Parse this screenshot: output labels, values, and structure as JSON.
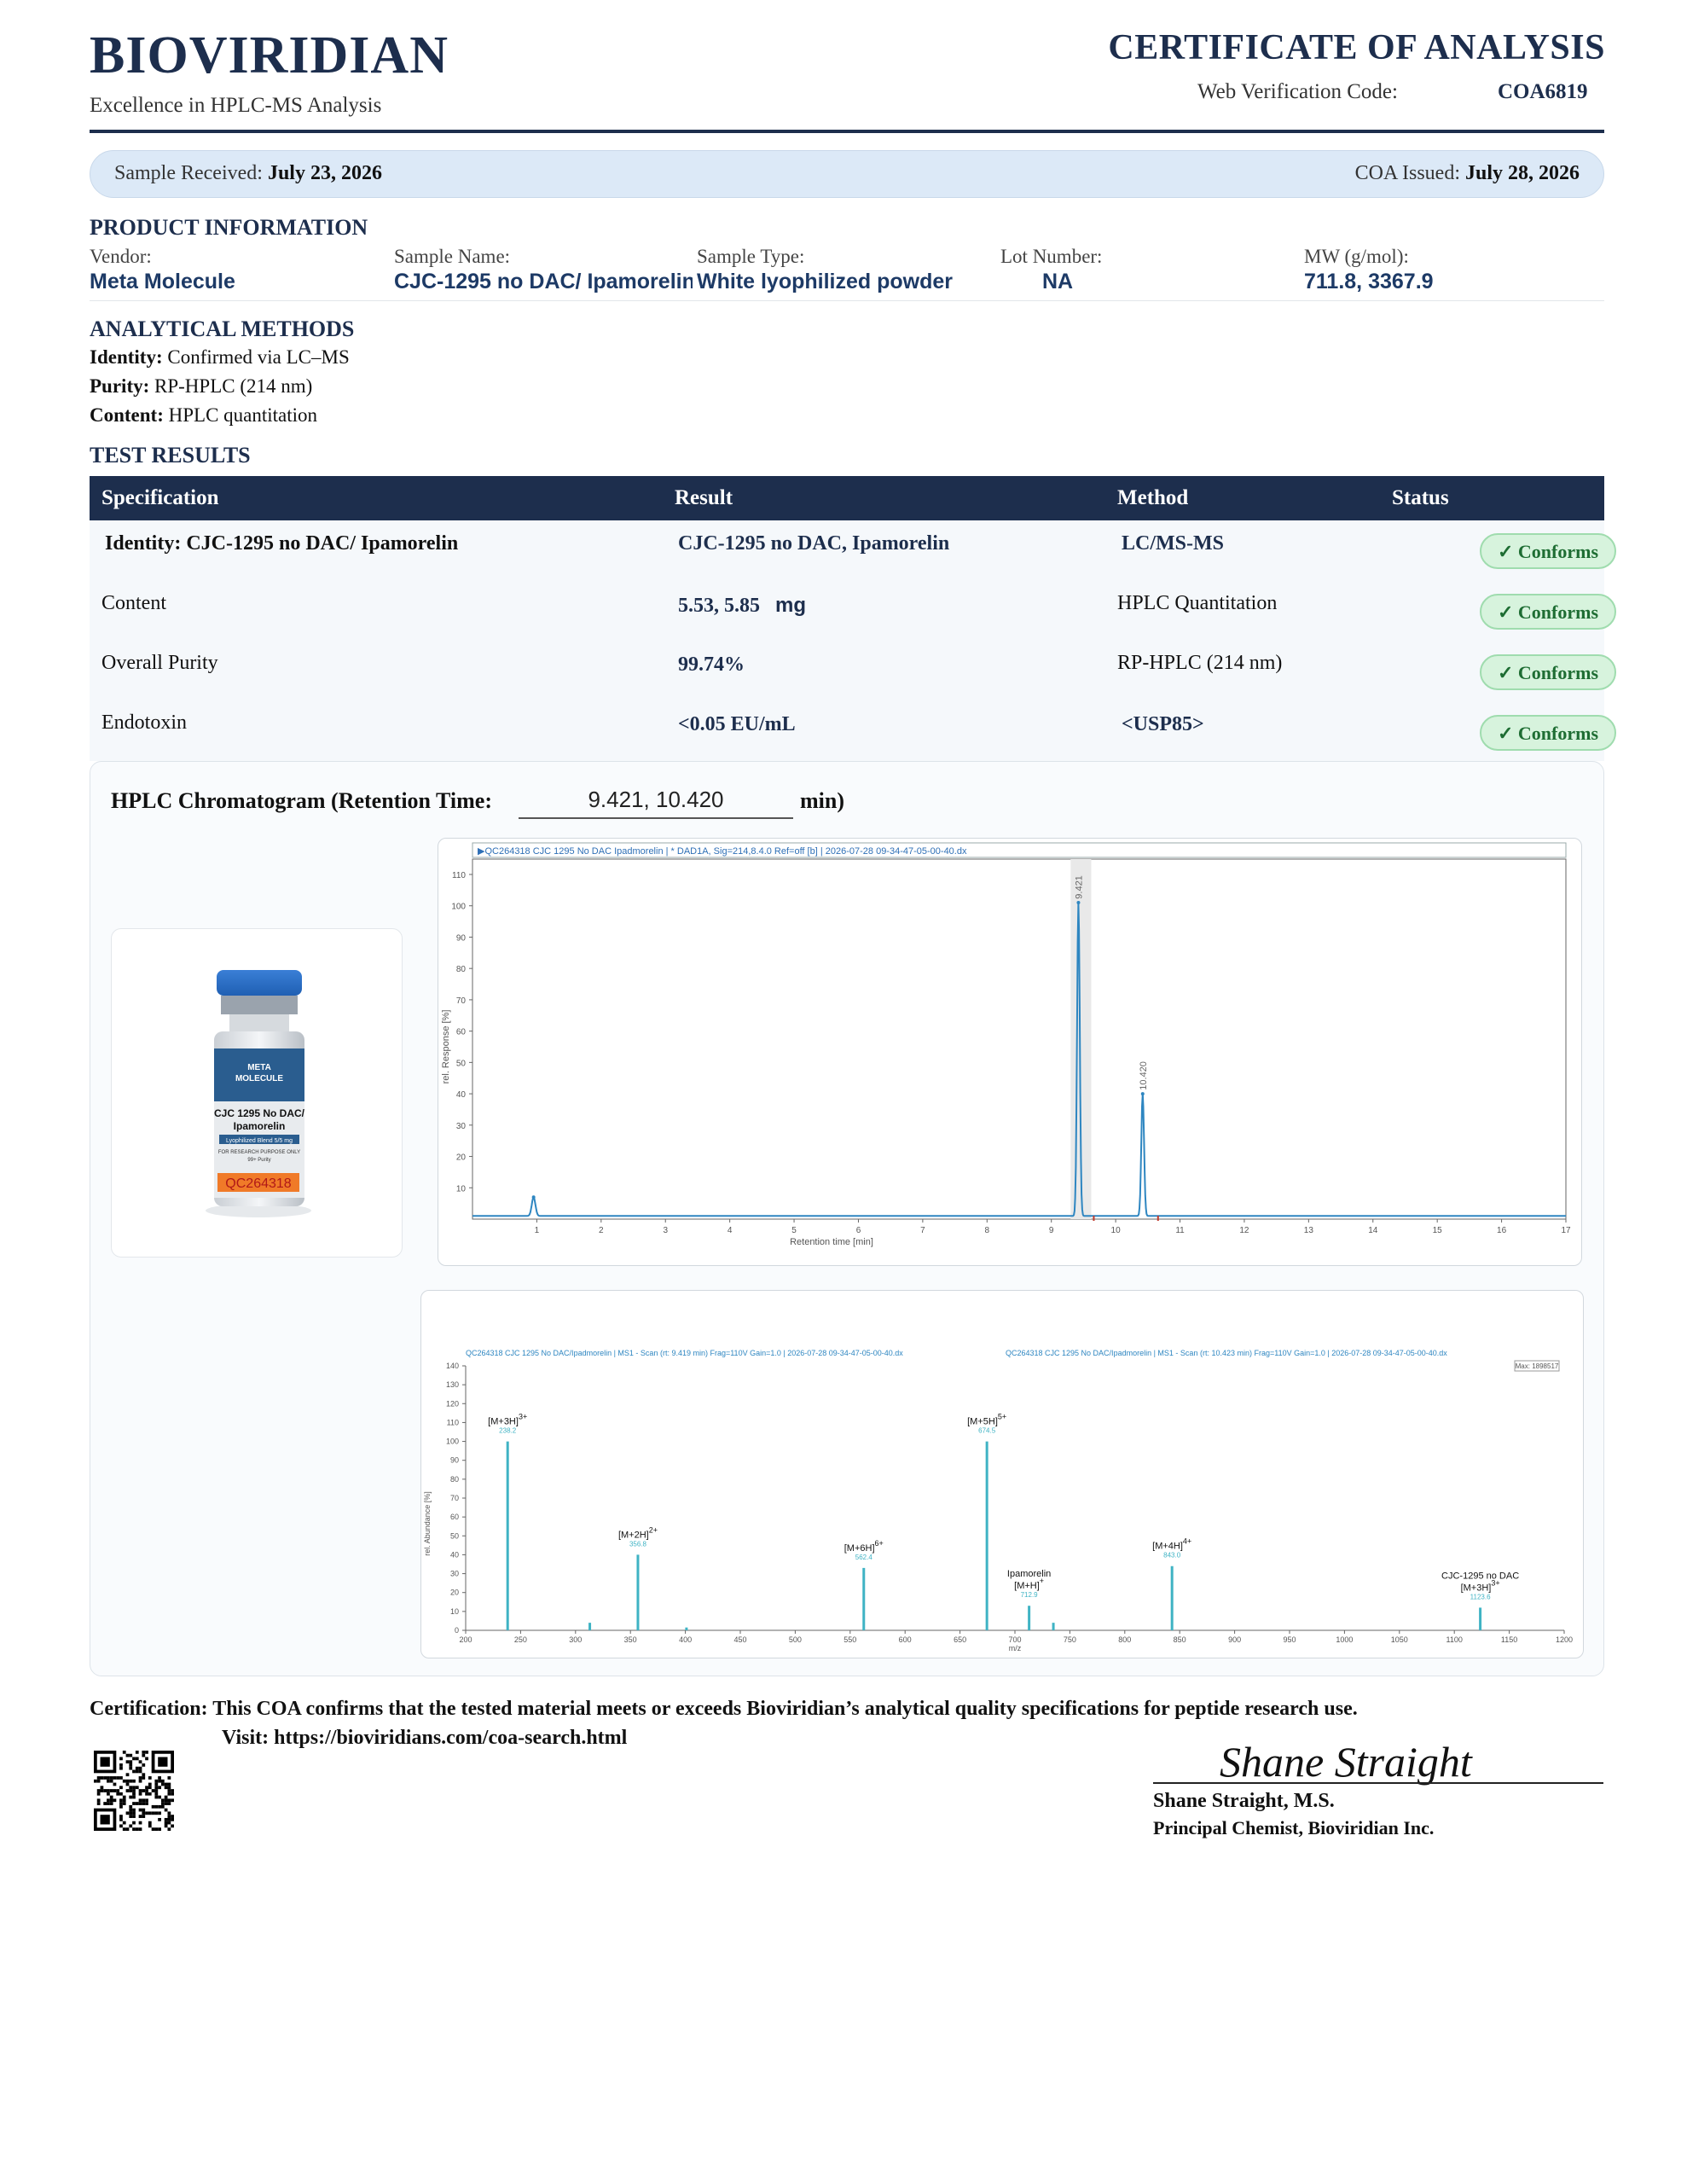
{
  "header": {
    "brand": "BIOVIRIDIAN",
    "tagline": "Excellence in HPLC-MS Analysis",
    "doc_title": "CERTIFICATE OF ANALYSIS",
    "verification_label": "Web Verification Code:",
    "verification_code": "COA6819"
  },
  "dates": {
    "received_label": "Sample Received:",
    "received_value": "July 23, 2026",
    "issued_label": "COA Issued:",
    "issued_value": "July 28, 2026"
  },
  "product": {
    "heading": "PRODUCT INFORMATION",
    "fields": [
      {
        "label": "Vendor:",
        "value": "Meta Molecule"
      },
      {
        "label": "Sample Name:",
        "value": "CJC-1295 no DAC/ Ipamorelin"
      },
      {
        "label": "Sample Type:",
        "value": "White lyophilized powder"
      },
      {
        "label": "Lot Number:",
        "value": "NA"
      },
      {
        "label": "MW (g/mol):",
        "value": "711.8, 3367.9"
      }
    ]
  },
  "methods": {
    "heading": "ANALYTICAL METHODS",
    "items": [
      {
        "label": "Identity:",
        "value": "Confirmed via LC–MS"
      },
      {
        "label": "Purity:",
        "value": "RP-HPLC (214 nm)"
      },
      {
        "label": "Content:",
        "value": "HPLC quantitation"
      }
    ]
  },
  "results": {
    "heading": "TEST RESULTS",
    "columns": [
      "Specification",
      "Result",
      "Method",
      "Status"
    ],
    "rows": [
      {
        "spec": "Identity:  CJC-1295 no DAC/ Ipamorelin",
        "result": "CJC-1295 no DAC, Ipamorelin",
        "result_unit": "",
        "method": "LC/MS-MS",
        "status": "✓ Conforms"
      },
      {
        "spec": "Content",
        "result": "5.53, 5.85",
        "result_unit": "mg",
        "method": "HPLC Quantitation",
        "status": "✓ Conforms"
      },
      {
        "spec": "Overall Purity",
        "result": "99.74%",
        "result_unit": "",
        "method": "RP-HPLC (214 nm)",
        "status": "✓ Conforms"
      },
      {
        "spec": "Endotoxin",
        "result": "<0.05 EU/mL",
        "result_unit": "",
        "method": "<USP85>",
        "status": "✓ Conforms"
      }
    ]
  },
  "chromatogram": {
    "label": "HPLC Chromatogram (Retention Time:",
    "retention_value": "9.421, 10.420",
    "label_end": "min)"
  },
  "vial": {
    "brand_line1": "META",
    "brand_line2": "MOLECULE",
    "name_line1": "CJC 1295 No DAC/",
    "name_line2": "Ipamorelin",
    "strip": "Lyophilized Blend   5/5 mg",
    "note1": "FOR RESEARCH PURPOSE ONLY",
    "note2": "99+ Purity",
    "lot_sticker": "QC264318"
  },
  "chart_data": [
    {
      "type": "line",
      "header": "QC264318 CJC 1295 No DAC Ipadmorelin | * DAD1A, Sig=214,8.4.0 Ref=off [b] | 2026-07-28 09-34-47-05-00-40.dx",
      "xlabel": "Retention time [min]",
      "ylabel": "rel. Response [%]",
      "xlim": [
        0,
        17
      ],
      "ylim": [
        0,
        110
      ],
      "xticks": [
        1,
        2,
        3,
        4,
        5,
        6,
        7,
        8,
        9,
        10,
        11,
        12,
        13,
        14,
        15,
        16,
        17
      ],
      "yticks": [
        10,
        20,
        30,
        40,
        50,
        60,
        70,
        80,
        90,
        100,
        110
      ],
      "peaks": [
        {
          "x": 0.95,
          "y": 6,
          "w": 0.04
        },
        {
          "x": 9.421,
          "y": 100,
          "w": 0.03,
          "label": "9.421"
        },
        {
          "x": 10.42,
          "y": 39,
          "w": 0.03,
          "label": "10.420"
        }
      ],
      "baseline": 1
    },
    {
      "type": "bar",
      "header_left": "QC264318 CJC 1295 No DAC/Ipadmorelin | MS1 - Scan (rt: 9.419 min) Frag=110V Gain=1.0 | 2026-07-28 09-34-47-05-00-40.dx",
      "header_right": "QC264318 CJC 1295 No DAC/Ipadmorelin | MS1 - Scan (rt: 10.423 min) Frag=110V Gain=1.0 | 2026-07-28 09-34-47-05-00-40.dx",
      "max_label": "Max: 1898517",
      "xlabel": "m/z",
      "ylabel": "rel. Abundance [%]",
      "xlim": [
        200,
        1200
      ],
      "ylim": [
        0,
        140
      ],
      "xticks": [
        200,
        250,
        300,
        350,
        400,
        450,
        500,
        550,
        600,
        650,
        700,
        750,
        800,
        850,
        900,
        950,
        1000,
        1050,
        1100,
        1150,
        1200
      ],
      "yticks": [
        0,
        10,
        20,
        30,
        40,
        50,
        60,
        70,
        80,
        90,
        100,
        110,
        120,
        130,
        140
      ],
      "peaks": [
        {
          "mz": 238.2,
          "y": 100,
          "ion": "[M+3H]",
          "charge": "3+",
          "value_label": "238.2"
        },
        {
          "mz": 356.8,
          "y": 40,
          "ion": "[M+2H]",
          "charge": "2+",
          "value_label": "356.8"
        },
        {
          "mz": 562.4,
          "y": 33,
          "ion": "[M+6H]",
          "charge": "6+",
          "value_label": "562.4"
        },
        {
          "mz": 674.5,
          "y": 100,
          "ion": "[M+5H]",
          "charge": "5+",
          "value_label": "674.5"
        },
        {
          "mz": 712.9,
          "y": 13,
          "ion": "Ipamorelin\n[M+H]",
          "charge": "+",
          "value_label": "712.9"
        },
        {
          "mz": 843.0,
          "y": 34,
          "ion": "[M+4H]",
          "charge": "4+",
          "value_label": "843.0"
        },
        {
          "mz": 1123.6,
          "y": 12,
          "ion": "CJC-1295 no DAC\n[M+3H]",
          "charge": "3+",
          "value_label": "1123.6"
        },
        {
          "mz": 313,
          "y": 4
        },
        {
          "mz": 401,
          "y": 1.5
        },
        {
          "mz": 735,
          "y": 4
        }
      ]
    }
  ],
  "certification": {
    "label": "Certification:",
    "text": "This COA confirms that the tested material meets or exceeds Bioviridian’s analytical quality specifications for peptide research use.",
    "visit": "Visit: https://bioviridians.com/coa-search.html"
  },
  "signature": {
    "script": "Shane Straight",
    "name": "Shane Straight, M.S.",
    "title": "Principal Chemist, Bioviridian Inc."
  },
  "colors": {
    "navy": "#1d2e4d",
    "trace": "#2e86c1",
    "ms_bar": "#3fb3c4",
    "conform_bg": "#d7f3dd"
  }
}
